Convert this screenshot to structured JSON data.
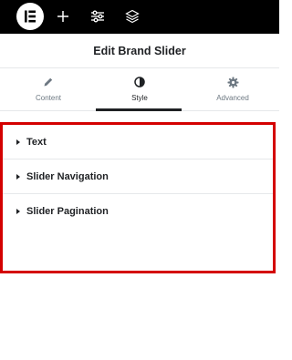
{
  "topbar": {
    "icons": [
      "elementor-logo-icon",
      "plus-icon",
      "sliders-icon",
      "layers-icon"
    ]
  },
  "panel": {
    "title": "Edit Brand Slider"
  },
  "tabs": [
    {
      "label": "Content",
      "icon": "pencil-icon",
      "active": false
    },
    {
      "label": "Style",
      "icon": "half-circle-icon",
      "active": true
    },
    {
      "label": "Advanced",
      "icon": "gear-icon",
      "active": false
    }
  ],
  "sections": [
    {
      "label": "Text"
    },
    {
      "label": "Slider Navigation"
    },
    {
      "label": "Slider Pagination"
    }
  ],
  "colors": {
    "topbar": "#000000",
    "highlight_border": "#d40000",
    "text": "#1f2124",
    "muted": "#6d7882"
  }
}
